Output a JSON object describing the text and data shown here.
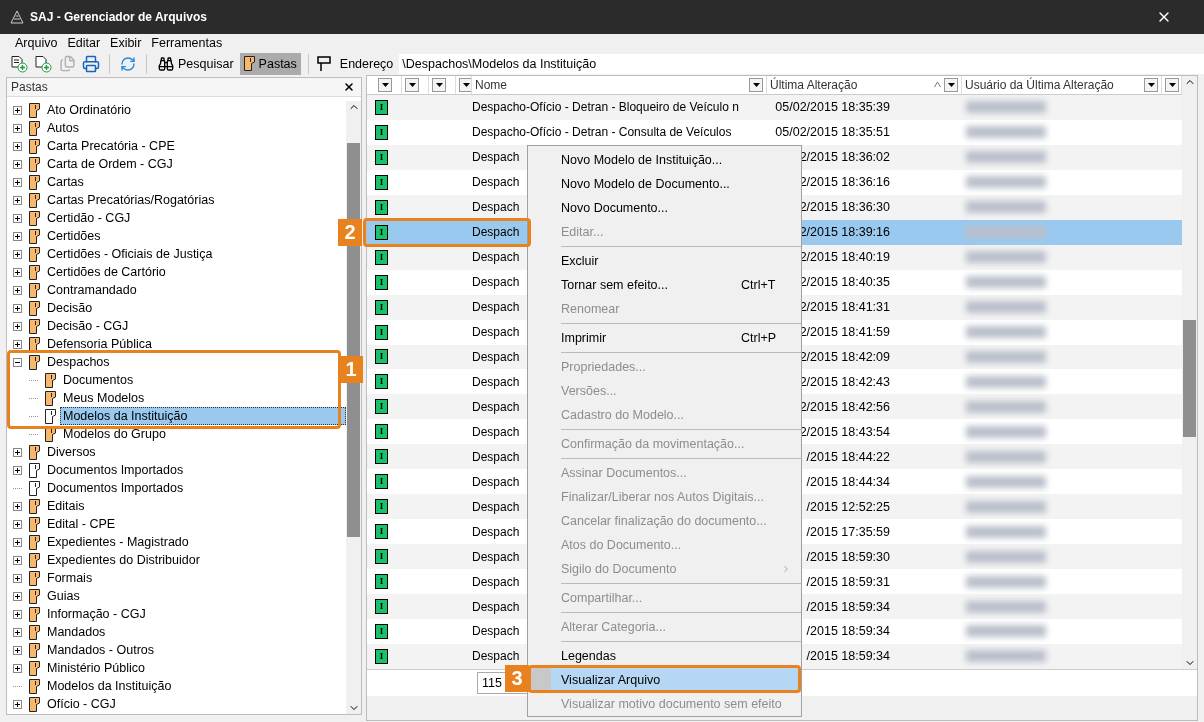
{
  "window": {
    "title": "SAJ - Gerenciador de Arquivos"
  },
  "menu_bar": [
    {
      "label": "Arquivo"
    },
    {
      "label": "Editar"
    },
    {
      "label": "Exibir"
    },
    {
      "label": "Ferramentas"
    }
  ],
  "toolbar": {
    "tools": [
      {
        "kind": "new-model",
        "disabled": false
      },
      {
        "kind": "new-document",
        "disabled": false
      },
      {
        "kind": "documents",
        "disabled": true
      },
      {
        "kind": "print",
        "disabled": false
      },
      {
        "kind": "refresh",
        "disabled": false
      }
    ],
    "buttons": [
      {
        "kind": "search",
        "label": "Pesquisar",
        "selected": false
      },
      {
        "kind": "folders",
        "label": "Pastas",
        "selected": true
      }
    ],
    "address": {
      "label": "Endereço",
      "value": "\\Despachos\\Modelos da Instituição"
    }
  },
  "folders_panel": {
    "title": "Pastas",
    "tree": [
      {
        "label": "Ato Ordinatório",
        "kind": "branch",
        "expanded": false,
        "selected": false,
        "color": "#f9b76b"
      },
      {
        "label": "Autos",
        "kind": "branch",
        "expanded": false,
        "selected": false,
        "color": "#f9b76b"
      },
      {
        "label": "Carta Precatória - CPE",
        "kind": "branch",
        "expanded": false,
        "selected": false,
        "color": "#f9b76b"
      },
      {
        "label": "Carta de Ordem - CGJ",
        "kind": "branch",
        "expanded": false,
        "selected": false,
        "color": "#f9b76b"
      },
      {
        "label": "Cartas",
        "kind": "branch",
        "expanded": false,
        "selected": false,
        "color": "#f9b76b"
      },
      {
        "label": "Cartas Precatórias/Rogatórias",
        "kind": "branch",
        "expanded": false,
        "selected": false,
        "color": "#f9b76b"
      },
      {
        "label": "Certidão - CGJ",
        "kind": "branch",
        "expanded": false,
        "selected": false,
        "color": "#f9b76b"
      },
      {
        "label": "Certidões",
        "kind": "branch",
        "expanded": false,
        "selected": false,
        "color": "#f9b76b"
      },
      {
        "label": "Certidões - Oficiais de Justiça",
        "kind": "branch",
        "expanded": false,
        "selected": false,
        "color": "#f9b76b"
      },
      {
        "label": "Certidões de Cartório",
        "kind": "branch",
        "expanded": false,
        "selected": false,
        "color": "#f9b76b"
      },
      {
        "label": "Contramandado",
        "kind": "branch",
        "expanded": false,
        "selected": false,
        "color": "#f9b76b"
      },
      {
        "label": "Decisão",
        "kind": "branch",
        "expanded": false,
        "selected": false,
        "color": "#f9b76b"
      },
      {
        "label": "Decisão - CGJ",
        "kind": "branch",
        "expanded": false,
        "selected": false,
        "color": "#f9b76b"
      },
      {
        "label": "Defensoria Pública",
        "kind": "branch",
        "expanded": false,
        "selected": false,
        "color": "#f9b76b"
      },
      {
        "label": "Despachos",
        "kind": "branch",
        "expanded": true,
        "selected": false,
        "color": "#f9b76b",
        "children": [
          {
            "label": "Documentos",
            "kind": "leaf",
            "selected": false,
            "color": "#f9b76b"
          },
          {
            "label": "Meus Modelos",
            "kind": "leaf",
            "selected": false,
            "color": "#f9b76b"
          },
          {
            "label": "Modelos da Instituição",
            "kind": "leaf",
            "selected": true,
            "color": "#ffffff"
          },
          {
            "label": "Modelos do Grupo",
            "kind": "leaf",
            "selected": false,
            "color": "#f9b76b"
          }
        ]
      },
      {
        "label": "Diversos",
        "kind": "branch",
        "expanded": false,
        "selected": false,
        "color": "#f9b76b"
      },
      {
        "label": "Documentos Importados",
        "kind": "branch",
        "expanded": false,
        "selected": false,
        "color": "#ffffff"
      },
      {
        "label": "Documentos Importados",
        "kind": "leaf",
        "selected": false,
        "color": "#ffffff"
      },
      {
        "label": "Editais",
        "kind": "branch",
        "expanded": false,
        "selected": false,
        "color": "#f9b76b"
      },
      {
        "label": "Edital - CPE",
        "kind": "branch",
        "expanded": false,
        "selected": false,
        "color": "#f9b76b"
      },
      {
        "label": "Expedientes - Magistrado",
        "kind": "branch",
        "expanded": false,
        "selected": false,
        "color": "#f9b76b"
      },
      {
        "label": "Expedientes do Distribuidor",
        "kind": "branch",
        "expanded": false,
        "selected": false,
        "color": "#f9b76b"
      },
      {
        "label": "Formais",
        "kind": "branch",
        "expanded": false,
        "selected": false,
        "color": "#f9b76b"
      },
      {
        "label": "Guias",
        "kind": "branch",
        "expanded": false,
        "selected": false,
        "color": "#f9b76b"
      },
      {
        "label": "Informação - CGJ",
        "kind": "branch",
        "expanded": false,
        "selected": false,
        "color": "#f9b76b"
      },
      {
        "label": "Mandados",
        "kind": "branch",
        "expanded": false,
        "selected": false,
        "color": "#f9b76b"
      },
      {
        "label": "Mandados - Outros",
        "kind": "branch",
        "expanded": false,
        "selected": false,
        "color": "#f9b76b"
      },
      {
        "label": "Ministério Público",
        "kind": "branch",
        "expanded": false,
        "selected": false,
        "color": "#f9b76b"
      },
      {
        "label": "Modelos da Instituição",
        "kind": "leaf",
        "selected": false,
        "color": "#f9b76b"
      },
      {
        "label": "Ofício - CGJ",
        "kind": "branch",
        "expanded": false,
        "selected": false,
        "color": "#f9b76b"
      }
    ]
  },
  "file_list": {
    "columns": [
      {
        "label": "Nome"
      },
      {
        "label": "Última Alteração",
        "sorted": true
      },
      {
        "label": "Usuário da Última Alteração"
      }
    ],
    "rows": [
      {
        "badge": "I",
        "name": "Despacho-Ofício - Detran - Bloqueiro de Veículo n",
        "modified": "05/02/2015 18:35:39",
        "selected": false
      },
      {
        "badge": "I",
        "name": "Despacho-Ofício - Detran - Consulta de Veículos",
        "modified": "05/02/2015 18:35:51",
        "selected": false
      },
      {
        "badge": "I",
        "name": "Despach",
        "modified": "2/2015 18:36:02",
        "selected": false
      },
      {
        "badge": "I",
        "name": "Despach",
        "modified": "2/2015 18:36:16",
        "selected": false
      },
      {
        "badge": "I",
        "name": "Despach",
        "modified": "2/2015 18:36:30",
        "selected": false
      },
      {
        "badge": "I",
        "name": "Despach",
        "modified": "2/2015 18:39:16",
        "selected": true
      },
      {
        "badge": "I",
        "name": "Despach",
        "modified": "2/2015 18:40:19",
        "selected": false
      },
      {
        "badge": "I",
        "name": "Despach",
        "modified": "2/2015 18:40:35",
        "selected": false
      },
      {
        "badge": "I",
        "name": "Despach",
        "modified": "2/2015 18:41:31",
        "selected": false
      },
      {
        "badge": "I",
        "name": "Despach",
        "modified": "2/2015 18:41:59",
        "selected": false
      },
      {
        "badge": "I",
        "name": "Despach",
        "modified": "2/2015 18:42:09",
        "selected": false
      },
      {
        "badge": "I",
        "name": "Despach",
        "modified": "2/2015 18:42:43",
        "selected": false
      },
      {
        "badge": "I",
        "name": "Despach",
        "modified": "2/2015 18:42:56",
        "selected": false
      },
      {
        "badge": "I",
        "name": "Despach",
        "modified": "2/2015 18:43:54",
        "selected": false
      },
      {
        "badge": "I",
        "name": "Despach",
        "modified": "/2015 18:44:22",
        "selected": false
      },
      {
        "badge": "I",
        "name": "Despach",
        "modified": "/2015 18:44:34",
        "selected": false
      },
      {
        "badge": "I",
        "name": "Despach",
        "modified": "/2015 12:52:25",
        "selected": false
      },
      {
        "badge": "I",
        "name": "Despach",
        "modified": "/2015 17:35:59",
        "selected": false
      },
      {
        "badge": "I",
        "name": "Despach",
        "modified": "/2015 18:59:30",
        "selected": false
      },
      {
        "badge": "I",
        "name": "Despach",
        "modified": "/2015 18:59:31",
        "selected": false
      },
      {
        "badge": "I",
        "name": "Despach",
        "modified": "/2015 18:59:34",
        "selected": false
      },
      {
        "badge": "I",
        "name": "Despach",
        "modified": "/2015 18:59:34",
        "selected": false
      },
      {
        "badge": "I",
        "name": "Despach",
        "modified": "/2015 18:59:34",
        "selected": false
      }
    ],
    "footer": {
      "value": "115"
    }
  },
  "context_menu": [
    {
      "kind": "item",
      "label": "Novo Modelo de Instituição...",
      "disabled": false,
      "selected": false
    },
    {
      "kind": "item",
      "label": "Novo Modelo de Documento...",
      "disabled": false,
      "selected": false
    },
    {
      "kind": "item",
      "label": "Novo Documento...",
      "disabled": false,
      "selected": false
    },
    {
      "kind": "item",
      "label": "Editar...",
      "disabled": true,
      "selected": false
    },
    {
      "kind": "separator"
    },
    {
      "kind": "item",
      "label": "Excluir",
      "disabled": false,
      "selected": false
    },
    {
      "kind": "item",
      "label": "Tornar sem efeito...",
      "shortcut": "Ctrl+T",
      "disabled": false,
      "selected": false
    },
    {
      "kind": "item",
      "label": "Renomear",
      "disabled": true,
      "selected": false
    },
    {
      "kind": "separator"
    },
    {
      "kind": "item",
      "label": "Imprimir",
      "shortcut": "Ctrl+P",
      "disabled": false,
      "selected": false
    },
    {
      "kind": "separator"
    },
    {
      "kind": "item",
      "label": "Propriedades...",
      "disabled": true,
      "selected": false
    },
    {
      "kind": "item",
      "label": "Versões...",
      "disabled": true,
      "selected": false
    },
    {
      "kind": "item",
      "label": "Cadastro do Modelo...",
      "disabled": true,
      "selected": false
    },
    {
      "kind": "separator"
    },
    {
      "kind": "item",
      "label": "Confirmação da movimentação...",
      "disabled": true,
      "selected": false
    },
    {
      "kind": "separator"
    },
    {
      "kind": "item",
      "label": "Assinar Documentos...",
      "disabled": true,
      "selected": false
    },
    {
      "kind": "item",
      "label": "Finalizar/Liberar nos Autos Digitais...",
      "disabled": true,
      "selected": false
    },
    {
      "kind": "item",
      "label": "Cancelar finalização do documento...",
      "disabled": true,
      "selected": false
    },
    {
      "kind": "item",
      "label": "Atos do Documento...",
      "disabled": true,
      "selected": false
    },
    {
      "kind": "item",
      "label": "Sigilo do Documento",
      "disabled": true,
      "selected": false,
      "submenu": true
    },
    {
      "kind": "separator"
    },
    {
      "kind": "item",
      "label": "Compartilhar...",
      "disabled": true,
      "selected": false
    },
    {
      "kind": "separator"
    },
    {
      "kind": "item",
      "label": "Alterar Categoria...",
      "disabled": true,
      "selected": false
    },
    {
      "kind": "separator"
    },
    {
      "kind": "item",
      "label": "Legendas",
      "disabled": false,
      "selected": false
    },
    {
      "kind": "item",
      "label": "Visualizar Arquivo",
      "disabled": false,
      "selected": true
    },
    {
      "kind": "item",
      "label": "Visualizar motivo documento sem efeito",
      "disabled": true,
      "selected": false
    }
  ],
  "callouts": [
    {
      "number": "1"
    },
    {
      "number": "2"
    },
    {
      "number": "3"
    }
  ]
}
